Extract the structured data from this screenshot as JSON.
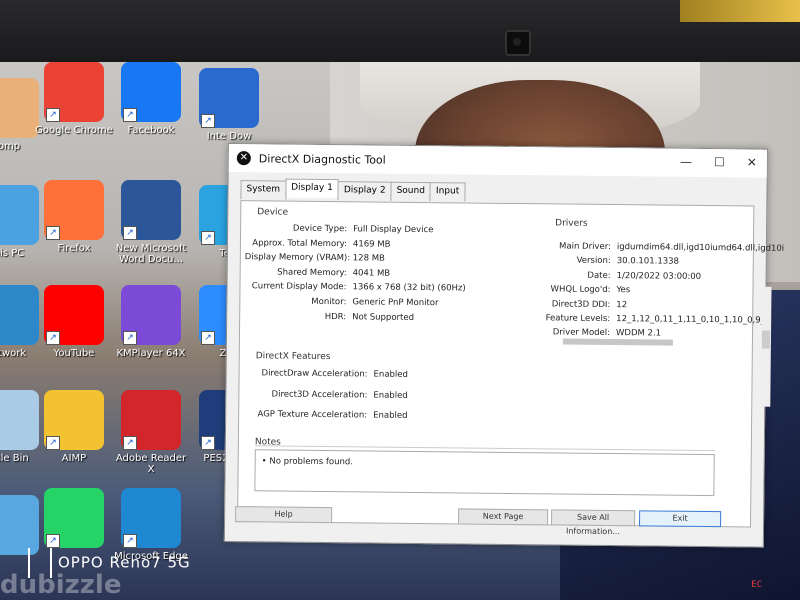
{
  "desktop": {
    "icons": [
      {
        "label": "omp",
        "color": "#e9b07a"
      },
      {
        "label": "Google Chrome",
        "color": "#ea4335"
      },
      {
        "label": "Facebook",
        "color": "#1877f2"
      },
      {
        "label": "Inte Dow",
        "color": "#2a6ad0"
      },
      {
        "label": "his PC",
        "color": "#4aa3e0"
      },
      {
        "label": "Firefox",
        "color": "#ff7139"
      },
      {
        "label": "New Microsoft Word Docu...",
        "color": "#2b579a"
      },
      {
        "label": "Tele",
        "color": "#2aa3e0"
      },
      {
        "label": "etwork",
        "color": "#2e87c9"
      },
      {
        "label": "YouTube",
        "color": "#ff0000"
      },
      {
        "label": "KMPlayer 64X",
        "color": "#7b4bd8"
      },
      {
        "label": "Zoo",
        "color": "#2d8cff"
      },
      {
        "label": "ycle Bin",
        "color": "#aacbe6"
      },
      {
        "label": "AIMP",
        "color": "#f2c230"
      },
      {
        "label": "Adobe Reader X",
        "color": "#d3262b"
      },
      {
        "label": "PES2 Shor",
        "color": "#1f3d7a"
      },
      {
        "label": "",
        "color": "#59a7e0"
      },
      {
        "label": "",
        "color": "#25d366"
      },
      {
        "label": "Microsoft Edge",
        "color": "#1e88d3"
      }
    ]
  },
  "window": {
    "title": "DirectX Diagnostic Tool",
    "controls": {
      "minimize": "—",
      "maximize": "☐",
      "close": "✕"
    },
    "tabs": [
      "System",
      "Display 1",
      "Display 2",
      "Sound",
      "Input"
    ],
    "active_tab": "Display 1",
    "device": {
      "group_label": "Device",
      "rows": [
        {
          "k": "Device Type:",
          "v": "Full Display Device"
        },
        {
          "k": "Approx. Total Memory:",
          "v": "4169 MB"
        },
        {
          "k": "Display Memory (VRAM):",
          "v": "128 MB"
        },
        {
          "k": "Shared Memory:",
          "v": "4041 MB"
        },
        {
          "k": "Current Display Mode:",
          "v": "1366 x 768 (32 bit) (60Hz)"
        },
        {
          "k": "Monitor:",
          "v": "Generic PnP Monitor"
        },
        {
          "k": "HDR:",
          "v": "Not Supported"
        }
      ]
    },
    "drivers": {
      "group_label": "Drivers",
      "rows": [
        {
          "k": "Main Driver:",
          "v": "igdumdim64.dll,igd10iumd64.dll,igd10i"
        },
        {
          "k": "Version:",
          "v": "30.0.101.1338"
        },
        {
          "k": "Date:",
          "v": "1/20/2022 03:00:00"
        },
        {
          "k": "WHQL Logo'd:",
          "v": "Yes"
        },
        {
          "k": "Direct3D DDI:",
          "v": "12"
        },
        {
          "k": "Feature Levels:",
          "v": "12_1,12_0,11_1,11_0,10_1,10_0,9_"
        },
        {
          "k": "Driver Model:",
          "v": "WDDM 2.1"
        }
      ]
    },
    "features": {
      "group_label": "DirectX Features",
      "rows": [
        {
          "k": "DirectDraw Acceleration:",
          "v": "Enabled"
        },
        {
          "k": "Direct3D Acceleration:",
          "v": "Enabled"
        },
        {
          "k": "AGP Texture Acceleration:",
          "v": "Enabled"
        }
      ]
    },
    "notes": {
      "group_label": "Notes",
      "items": [
        "No problems found."
      ]
    },
    "buttons": {
      "help": "Help",
      "next": "Next Page",
      "save": "Save All Information...",
      "exit": "Exit"
    }
  },
  "watermark": {
    "camera": "OPPO Reno7 5G",
    "site": "dubizzle"
  },
  "taskbar": {
    "corner_text": "EC"
  }
}
